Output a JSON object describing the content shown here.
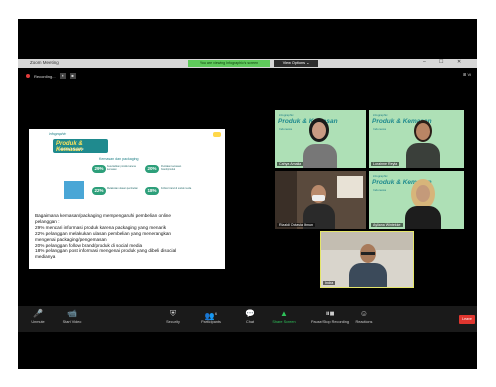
{
  "window": {
    "title": "Zoom Meeting",
    "controls": [
      "–",
      "☐",
      "✕"
    ]
  },
  "share_banner": "You are viewing Infographic's screen",
  "view_options": "View Options ⌄",
  "recording": {
    "label": "Recording...",
    "pause": "⏸",
    "stop": "■"
  },
  "gallery_view": "⊞ Vi",
  "slide": {
    "brand": "infographic",
    "banner_title": "Produk & Kemasan",
    "banner_sub": "Indonesia Infographic",
    "heading": "Kemasan dan packaging",
    "stats": [
      {
        "value": "29%",
        "text": "Ketertarikan produk karena kemasan"
      },
      {
        "value": "20%",
        "text": "Penilaian kemasan brand/produk"
      },
      {
        "value": "22%",
        "text": "Melakukan ulasan pembelian"
      },
      {
        "value": "18%",
        "text": "Follow brand di social media"
      }
    ],
    "lines": [
      "Bagaimana kemasan/packaging mempengaruhi pembelian online",
      "pelanggan :",
      "29% mencari informasi produk karena packaging yang menarik",
      "22% pelanggan melakukan ulasan pembelian yang menerangkan",
      "mengenai packaging/pengemasan",
      "20% pelanggan follow brand/produk di social media",
      "18% pelanggan post informasi mengenai produk yang dibeli disocial",
      "medianya"
    ]
  },
  "participants": [
    {
      "name": "Cahya Amalia"
    },
    {
      "name": "Lorainne Reyla"
    },
    {
      "name": "Rizaldi Octavia Ibnun"
    },
    {
      "name": "Ayliana Wintekke"
    },
    {
      "name": "Indra"
    }
  ],
  "mini_slide": {
    "brand": "infographic",
    "title": "Produk & Kemasan",
    "sub": "Indonesia"
  },
  "toolbar": {
    "unmute": "Unmute",
    "start_video": "Start Video",
    "security": "Security",
    "participants": "Participants",
    "participants_count": "6",
    "chat": "Chat",
    "share_screen": "Share Screen",
    "pause_recording": "Pause/Stop Recording",
    "reactions": "Reactions",
    "leave": "Leave"
  }
}
